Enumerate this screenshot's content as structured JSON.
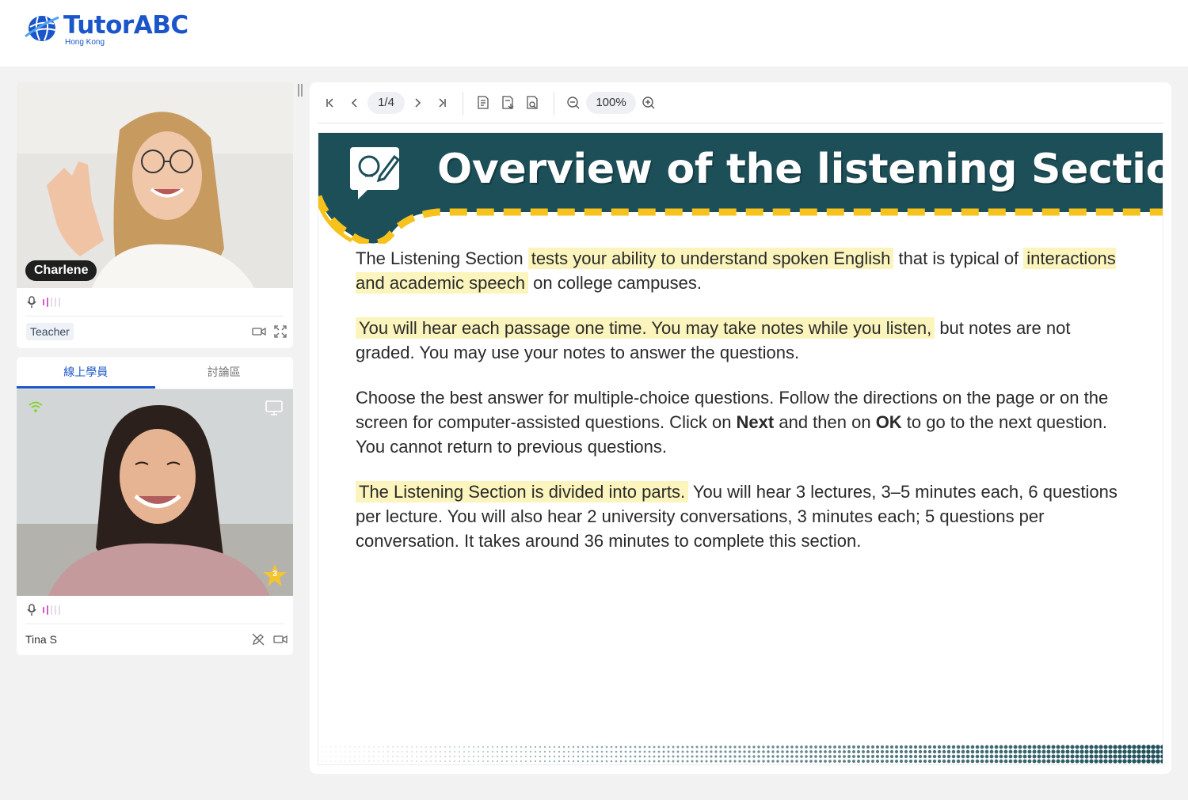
{
  "brand": {
    "name": "TutorABC",
    "region": "Hong Kong",
    "color": "#1a56c9"
  },
  "teacher": {
    "name": "Charlene",
    "role": "Teacher",
    "icons": [
      "microphone-icon",
      "video-camera-icon",
      "fullscreen-icon"
    ]
  },
  "students_panel": {
    "tabs": [
      {
        "label": "線上學員",
        "active": true
      },
      {
        "label": "討論區",
        "active": false
      }
    ],
    "student": {
      "name": "Tina S",
      "star_count": "3",
      "icons": [
        "wifi-icon",
        "screen-share-icon",
        "star-icon",
        "microphone-icon",
        "pen-disabled-icon",
        "video-camera-icon"
      ]
    }
  },
  "viewer": {
    "page_indicator": "1/4",
    "zoom": "100%",
    "buttons": [
      "first-page",
      "previous-page",
      "next-page",
      "last-page",
      "document-list",
      "document-download",
      "document-search",
      "zoom-out",
      "zoom-in"
    ]
  },
  "slide": {
    "title": "Overview of the listening Section",
    "p1_pre": "The Listening Section ",
    "p1_hl1": "tests your ability to understand spoken English",
    "p1_mid": " that is typical of ",
    "p1_hl2": "interactions and academic speech",
    "p1_post": " on college campuses.",
    "p2_hl": "You will hear each passage one time. You may take notes while you listen,",
    "p2_post": " but notes are not graded. You may use your notes to answer the questions.",
    "p3_pre": "Choose the best answer for multiple-choice questions. Follow the directions on the page or on the screen for computer-assisted questions. Click on ",
    "p3_b1": "Next",
    "p3_mid": " and then on ",
    "p3_b2": "OK",
    "p3_post": " to go to the next question. You cannot return to previous questions.",
    "p4_hl": "The Listening Section is divided into parts.",
    "p4_post": " You will hear 3 lectures, 3–5 minutes each, 6 questions per lecture. You will also hear 2 university conversations, 3 minutes each; 5 questions per conversation. It takes around 36 minutes to complete this section.",
    "colors": {
      "banner": "#1d4f59",
      "stripe": "#f6c21b",
      "highlight": "#fbf5bd"
    }
  }
}
